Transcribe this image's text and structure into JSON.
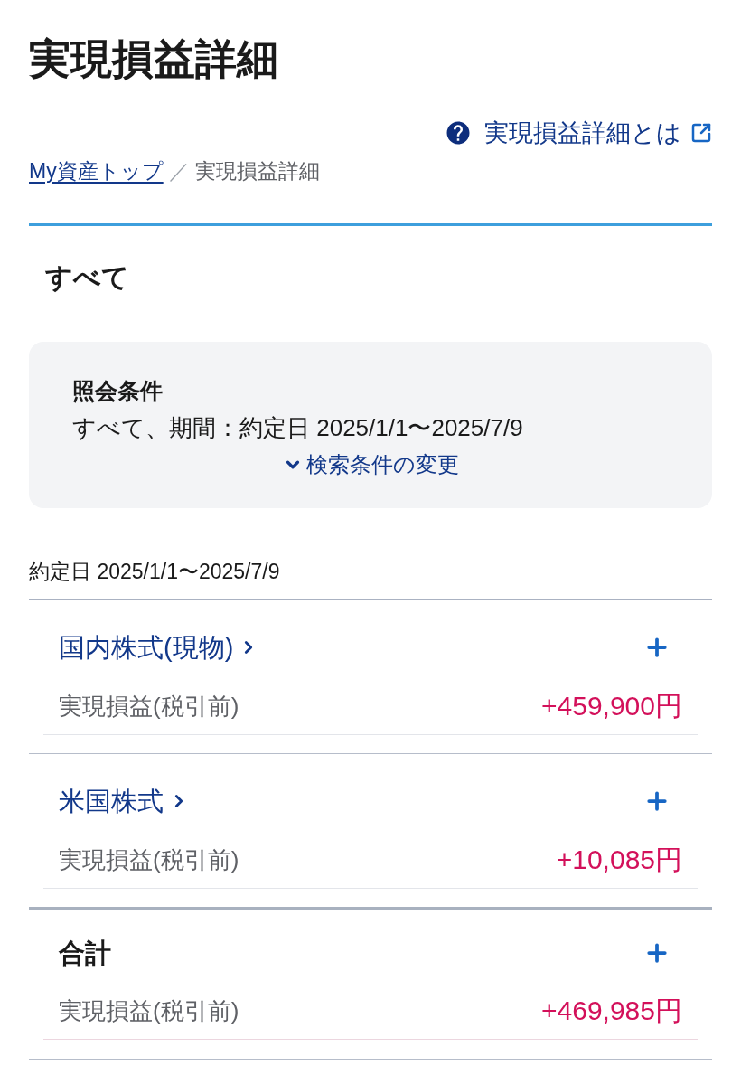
{
  "page": {
    "title": "実現損益詳細"
  },
  "help_link": {
    "label": "実現損益詳細とは"
  },
  "breadcrumb": {
    "items": [
      {
        "label": "My資産トップ",
        "kind": "link"
      },
      {
        "label": "実現損益詳細",
        "kind": "current"
      }
    ],
    "separator": "／"
  },
  "section_title": "すべて",
  "query_conditions": {
    "heading": "照会条件",
    "summary": "すべて、期間：約定日 2025/1/1〜2025/7/9",
    "change_link": "検索条件の変更"
  },
  "period_label": "約定日 2025/1/1〜2025/7/9",
  "groups": [
    {
      "name": "国内株式(現物)",
      "kind": "category",
      "expanded": false,
      "rows": [
        {
          "label": "実現損益(税引前)",
          "value": "+459,900円"
        }
      ]
    },
    {
      "name": "米国株式",
      "kind": "category",
      "expanded": false,
      "rows": [
        {
          "label": "実現損益(税引前)",
          "value": "+10,085円"
        }
      ]
    },
    {
      "name": "合計",
      "kind": "total",
      "expanded": false,
      "rows": [
        {
          "label": "実現損益(税引前)",
          "value": "+469,985円"
        }
      ]
    }
  ]
}
